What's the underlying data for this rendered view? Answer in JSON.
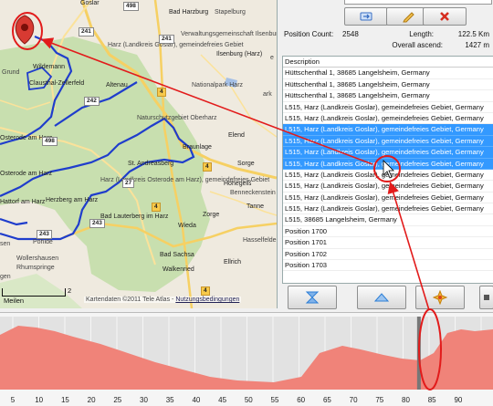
{
  "map": {
    "places": [
      "Goslar",
      "Bad Harzburg",
      "Stapelburg",
      "Harz (Landkreis Goslar), gemeindefreies Gebiet",
      "Verwaltungsgemeinschaft Ilsenburg",
      "Ilsenburg (Harz)",
      "Wildemann",
      "Clausthal-Zellerfeld",
      "Altenau",
      "Nationalpark Harz",
      "Naturschutzgebiet Oberharz",
      "Braunlage",
      "Osterode am Harz",
      "St. Andreasberg",
      "Elend",
      "Sorge",
      "Harz (Landkreis Osterode am Harz), gemeindefreies Gebiet",
      "Herzberg am Harz",
      "Bad Lauterberg im Harz",
      "Hohegeiß",
      "Benneckenstein (Harz)",
      "Tanne",
      "Zorge",
      "Wieda",
      "Bad Sachsa",
      "Walkenried",
      "Ellrich",
      "Wollershausen",
      "Rhumspringe",
      "Grund",
      "Hattorf am Harz",
      "Osterode am Harz",
      "sen",
      "gen",
      "e",
      "ark",
      "Hasselfelde",
      "Pöhlde"
    ],
    "roads": [
      "498",
      "241",
      "4",
      "242",
      "241",
      "4",
      "498",
      "27",
      "4",
      "243",
      "243",
      "4"
    ],
    "copyright": "Kartendaten ©2011 Tele Atlas - ",
    "terms_link": "Nutzungsbedingungen",
    "scale_label": "Meilen",
    "scale_value": "2"
  },
  "panel": {
    "toolbar": [
      {
        "name": "import-icon",
        "color": "#3a6fc4"
      },
      {
        "name": "edit-icon",
        "color": "#e7a21f"
      },
      {
        "name": "delete-icon",
        "color": "#d62d20"
      }
    ],
    "stats": {
      "position_count_label": "Position Count:",
      "position_count": "2548",
      "length_label": "Length:",
      "length": "122.5 Km",
      "ascend_label": "Overall ascend:",
      "ascend": "1427 m"
    },
    "list_header": "Description",
    "rows": [
      {
        "text": "Hüttschenthal 1, 38685 Langelsheim, Germany",
        "selected": false
      },
      {
        "text": "Hüttschenthal 1, 38685 Langelsheim, Germany",
        "selected": false
      },
      {
        "text": "Hüttschenthal 1, 38685 Langelsheim, Germany",
        "selected": false
      },
      {
        "text": "L515, Harz (Landkreis Goslar), gemeindefreies Gebiet, Germany",
        "selected": false
      },
      {
        "text": "L515, Harz (Landkreis Goslar), gemeindefreies Gebiet, Germany",
        "selected": false
      },
      {
        "text": "L515, Harz (Landkreis Goslar), gemeindefreies Gebiet, Germany",
        "selected": true
      },
      {
        "text": "L515, Harz (Landkreis Goslar), gemeindefreies Gebiet, Germany",
        "selected": true
      },
      {
        "text": "L515, Harz (Landkreis Goslar), gemeindefreies Gebiet, Germany",
        "selected": true
      },
      {
        "text": "L515, Harz (Landkreis Goslar), gemeindefreies Gebiet, Germany",
        "selected": true
      },
      {
        "text": "L515, Harz (Landkreis Goslar), gemeindefreies Gebiet, Germany",
        "selected": false
      },
      {
        "text": "L515, Harz (Landkreis Goslar), gemeindefreies Gebiet, Germany",
        "selected": false
      },
      {
        "text": "L515, Harz (Landkreis Goslar), gemeindefreies Gebiet, Germany",
        "selected": false
      },
      {
        "text": "L515, Harz (Landkreis Goslar), gemeindefreies Gebiet, Germany",
        "selected": false
      },
      {
        "text": "L515, 38685 Langelsheim, Germany",
        "selected": false
      },
      {
        "text": "Position 1700",
        "selected": false
      },
      {
        "text": "Position 1701",
        "selected": false
      },
      {
        "text": "Position 1702",
        "selected": false
      },
      {
        "text": "Position 1703",
        "selected": false
      }
    ],
    "buttons": [
      {
        "name": "first-position-icon",
        "color": "#2e7fd6"
      },
      {
        "name": "up-arrow-icon",
        "color": "#2e7fd6"
      },
      {
        "name": "locate-icon",
        "color": "#e8a21a"
      },
      {
        "name": "more-icon",
        "color": "#555"
      }
    ]
  },
  "profile": {
    "x_ticks": [
      "5",
      "10",
      "15",
      "20",
      "25",
      "30",
      "35",
      "40",
      "45",
      "50",
      "55",
      "60",
      "65",
      "70",
      "75",
      "80",
      "85",
      "90"
    ],
    "fill_color": "#f08379",
    "marker_position_km": 82.5
  },
  "colors": {
    "track": "#1f3dcc",
    "arrow": "#e21b1b",
    "selection": "#3399ff",
    "forest": "#c8dfaf"
  }
}
